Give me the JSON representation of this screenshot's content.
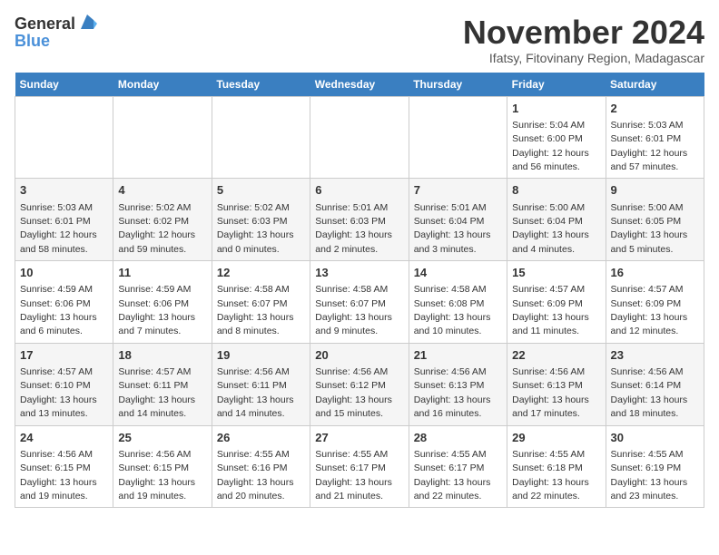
{
  "logo": {
    "general": "General",
    "blue": "Blue"
  },
  "title": "November 2024",
  "subtitle": "Ifatsy, Fitovinany Region, Madagascar",
  "weekdays": [
    "Sunday",
    "Monday",
    "Tuesday",
    "Wednesday",
    "Thursday",
    "Friday",
    "Saturday"
  ],
  "weeks": [
    [
      {
        "day": "",
        "info": ""
      },
      {
        "day": "",
        "info": ""
      },
      {
        "day": "",
        "info": ""
      },
      {
        "day": "",
        "info": ""
      },
      {
        "day": "",
        "info": ""
      },
      {
        "day": "1",
        "info": "Sunrise: 5:04 AM\nSunset: 6:00 PM\nDaylight: 12 hours and 56 minutes."
      },
      {
        "day": "2",
        "info": "Sunrise: 5:03 AM\nSunset: 6:01 PM\nDaylight: 12 hours and 57 minutes."
      }
    ],
    [
      {
        "day": "3",
        "info": "Sunrise: 5:03 AM\nSunset: 6:01 PM\nDaylight: 12 hours and 58 minutes."
      },
      {
        "day": "4",
        "info": "Sunrise: 5:02 AM\nSunset: 6:02 PM\nDaylight: 12 hours and 59 minutes."
      },
      {
        "day": "5",
        "info": "Sunrise: 5:02 AM\nSunset: 6:03 PM\nDaylight: 13 hours and 0 minutes."
      },
      {
        "day": "6",
        "info": "Sunrise: 5:01 AM\nSunset: 6:03 PM\nDaylight: 13 hours and 2 minutes."
      },
      {
        "day": "7",
        "info": "Sunrise: 5:01 AM\nSunset: 6:04 PM\nDaylight: 13 hours and 3 minutes."
      },
      {
        "day": "8",
        "info": "Sunrise: 5:00 AM\nSunset: 6:04 PM\nDaylight: 13 hours and 4 minutes."
      },
      {
        "day": "9",
        "info": "Sunrise: 5:00 AM\nSunset: 6:05 PM\nDaylight: 13 hours and 5 minutes."
      }
    ],
    [
      {
        "day": "10",
        "info": "Sunrise: 4:59 AM\nSunset: 6:06 PM\nDaylight: 13 hours and 6 minutes."
      },
      {
        "day": "11",
        "info": "Sunrise: 4:59 AM\nSunset: 6:06 PM\nDaylight: 13 hours and 7 minutes."
      },
      {
        "day": "12",
        "info": "Sunrise: 4:58 AM\nSunset: 6:07 PM\nDaylight: 13 hours and 8 minutes."
      },
      {
        "day": "13",
        "info": "Sunrise: 4:58 AM\nSunset: 6:07 PM\nDaylight: 13 hours and 9 minutes."
      },
      {
        "day": "14",
        "info": "Sunrise: 4:58 AM\nSunset: 6:08 PM\nDaylight: 13 hours and 10 minutes."
      },
      {
        "day": "15",
        "info": "Sunrise: 4:57 AM\nSunset: 6:09 PM\nDaylight: 13 hours and 11 minutes."
      },
      {
        "day": "16",
        "info": "Sunrise: 4:57 AM\nSunset: 6:09 PM\nDaylight: 13 hours and 12 minutes."
      }
    ],
    [
      {
        "day": "17",
        "info": "Sunrise: 4:57 AM\nSunset: 6:10 PM\nDaylight: 13 hours and 13 minutes."
      },
      {
        "day": "18",
        "info": "Sunrise: 4:57 AM\nSunset: 6:11 PM\nDaylight: 13 hours and 14 minutes."
      },
      {
        "day": "19",
        "info": "Sunrise: 4:56 AM\nSunset: 6:11 PM\nDaylight: 13 hours and 14 minutes."
      },
      {
        "day": "20",
        "info": "Sunrise: 4:56 AM\nSunset: 6:12 PM\nDaylight: 13 hours and 15 minutes."
      },
      {
        "day": "21",
        "info": "Sunrise: 4:56 AM\nSunset: 6:13 PM\nDaylight: 13 hours and 16 minutes."
      },
      {
        "day": "22",
        "info": "Sunrise: 4:56 AM\nSunset: 6:13 PM\nDaylight: 13 hours and 17 minutes."
      },
      {
        "day": "23",
        "info": "Sunrise: 4:56 AM\nSunset: 6:14 PM\nDaylight: 13 hours and 18 minutes."
      }
    ],
    [
      {
        "day": "24",
        "info": "Sunrise: 4:56 AM\nSunset: 6:15 PM\nDaylight: 13 hours and 19 minutes."
      },
      {
        "day": "25",
        "info": "Sunrise: 4:56 AM\nSunset: 6:15 PM\nDaylight: 13 hours and 19 minutes."
      },
      {
        "day": "26",
        "info": "Sunrise: 4:55 AM\nSunset: 6:16 PM\nDaylight: 13 hours and 20 minutes."
      },
      {
        "day": "27",
        "info": "Sunrise: 4:55 AM\nSunset: 6:17 PM\nDaylight: 13 hours and 21 minutes."
      },
      {
        "day": "28",
        "info": "Sunrise: 4:55 AM\nSunset: 6:17 PM\nDaylight: 13 hours and 22 minutes."
      },
      {
        "day": "29",
        "info": "Sunrise: 4:55 AM\nSunset: 6:18 PM\nDaylight: 13 hours and 22 minutes."
      },
      {
        "day": "30",
        "info": "Sunrise: 4:55 AM\nSunset: 6:19 PM\nDaylight: 13 hours and 23 minutes."
      }
    ]
  ]
}
